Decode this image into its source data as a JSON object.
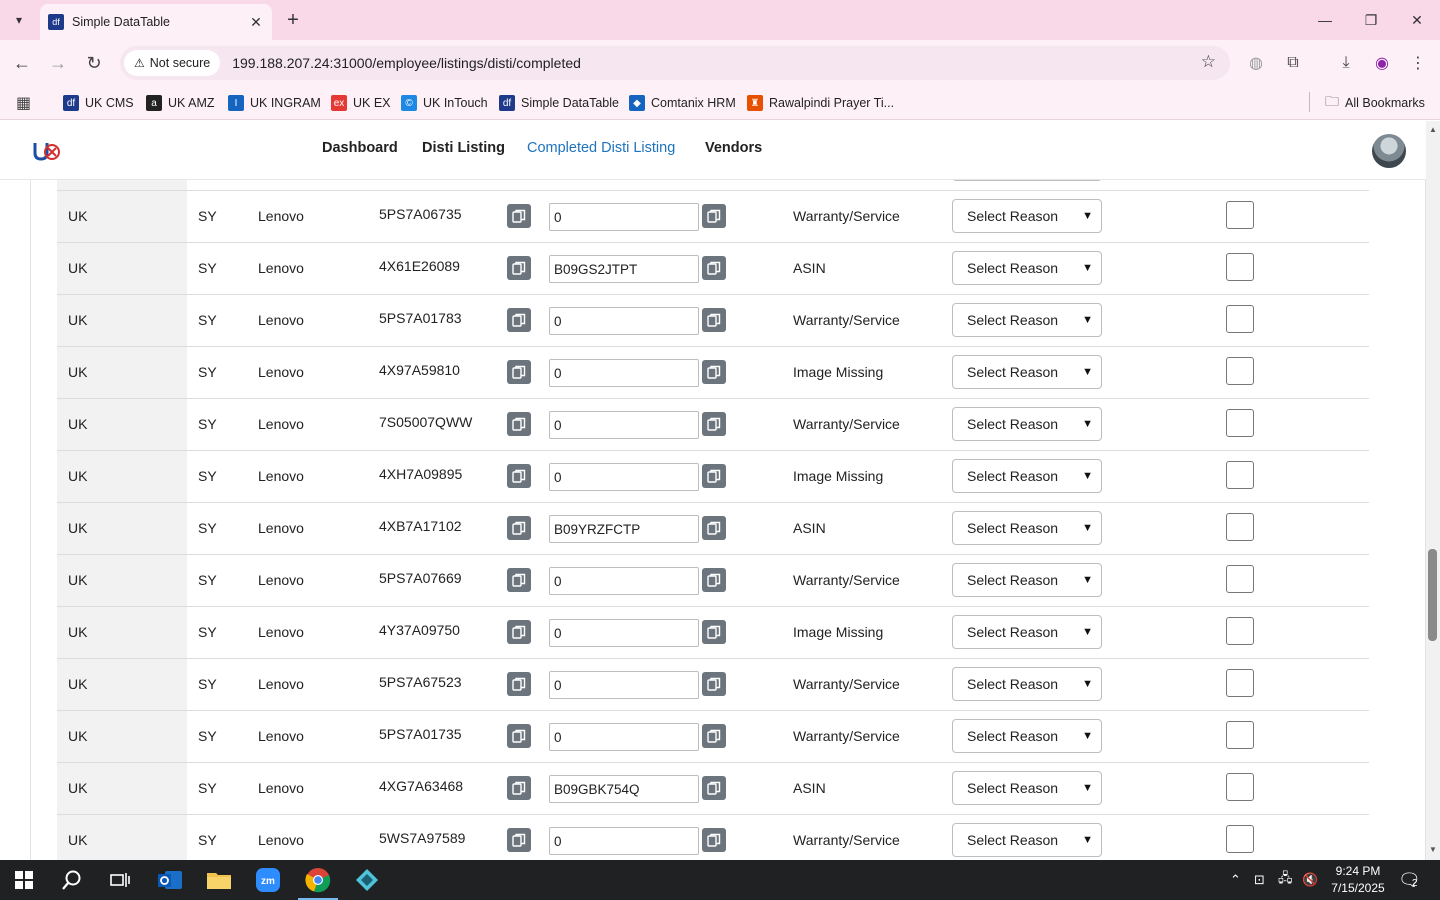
{
  "browser": {
    "tab_title": "Simple DataTable",
    "tab_favicon": "df",
    "security_label": "Not secure",
    "url": "199.188.207.24:31000/employee/listings/disti/completed",
    "bookmarks": [
      {
        "label": "UK CMS",
        "icon": "df",
        "color": "#1e3a8a"
      },
      {
        "label": "UK AMZ",
        "icon": "a",
        "color": "#222222"
      },
      {
        "label": "UK INGRAM",
        "icon": "I",
        "color": "#1565c0"
      },
      {
        "label": "UK EX",
        "icon": "ex",
        "color": "#e53935"
      },
      {
        "label": "UK InTouch",
        "icon": "©",
        "color": "#1e88e5"
      },
      {
        "label": "Simple DataTable",
        "icon": "df",
        "color": "#1e3a8a"
      },
      {
        "label": "Comtanix HRM",
        "icon": "◆",
        "color": "#1565c0"
      },
      {
        "label": "Rawalpindi Prayer Ti...",
        "icon": "♜",
        "color": "#e65100"
      }
    ],
    "all_bookmarks_label": "All Bookmarks"
  },
  "nav": {
    "links": [
      "Dashboard",
      "Disti Listing",
      "Completed Disti Listing",
      "Vendors"
    ],
    "active": "Completed Disti Listing"
  },
  "table": {
    "select_placeholder": "Select Reason",
    "rows": [
      {
        "country": "",
        "code": "",
        "brand": "",
        "sku": "",
        "value": "",
        "type": ""
      },
      {
        "country": "UK",
        "code": "SY",
        "brand": "Lenovo",
        "sku": "5PS7A06735",
        "value": "0",
        "type": "Warranty/Service"
      },
      {
        "country": "UK",
        "code": "SY",
        "brand": "Lenovo",
        "sku": "4X61E26089",
        "value": "B09GS2JTPT",
        "type": "ASIN"
      },
      {
        "country": "UK",
        "code": "SY",
        "brand": "Lenovo",
        "sku": "5PS7A01783",
        "value": "0",
        "type": "Warranty/Service"
      },
      {
        "country": "UK",
        "code": "SY",
        "brand": "Lenovo",
        "sku": "4X97A59810",
        "value": "0",
        "type": "Image Missing"
      },
      {
        "country": "UK",
        "code": "SY",
        "brand": "Lenovo",
        "sku": "7S05007QWW",
        "value": "0",
        "type": "Warranty/Service"
      },
      {
        "country": "UK",
        "code": "SY",
        "brand": "Lenovo",
        "sku": "4XH7A09895",
        "value": "0",
        "type": "Image Missing"
      },
      {
        "country": "UK",
        "code": "SY",
        "brand": "Lenovo",
        "sku": "4XB7A17102",
        "value": "B09YRZFCTP",
        "type": "ASIN"
      },
      {
        "country": "UK",
        "code": "SY",
        "brand": "Lenovo",
        "sku": "5PS7A07669",
        "value": "0",
        "type": "Warranty/Service"
      },
      {
        "country": "UK",
        "code": "SY",
        "brand": "Lenovo",
        "sku": "4Y37A09750",
        "value": "0",
        "type": "Image Missing"
      },
      {
        "country": "UK",
        "code": "SY",
        "brand": "Lenovo",
        "sku": "5PS7A67523",
        "value": "0",
        "type": "Warranty/Service"
      },
      {
        "country": "UK",
        "code": "SY",
        "brand": "Lenovo",
        "sku": "5PS7A01735",
        "value": "0",
        "type": "Warranty/Service"
      },
      {
        "country": "UK",
        "code": "SY",
        "brand": "Lenovo",
        "sku": "4XG7A63468",
        "value": "B09GBK754Q",
        "type": "ASIN"
      },
      {
        "country": "UK",
        "code": "SY",
        "brand": "Lenovo",
        "sku": "5WS7A97589",
        "value": "0",
        "type": "Warranty/Service"
      }
    ]
  },
  "taskbar": {
    "time": "9:24 PM",
    "date": "7/15/2025",
    "notification_count": "2"
  },
  "colors": {
    "accent": "#1e73be",
    "copy_button": "#6c757d",
    "chrome_pink": "#f9d9e7"
  }
}
